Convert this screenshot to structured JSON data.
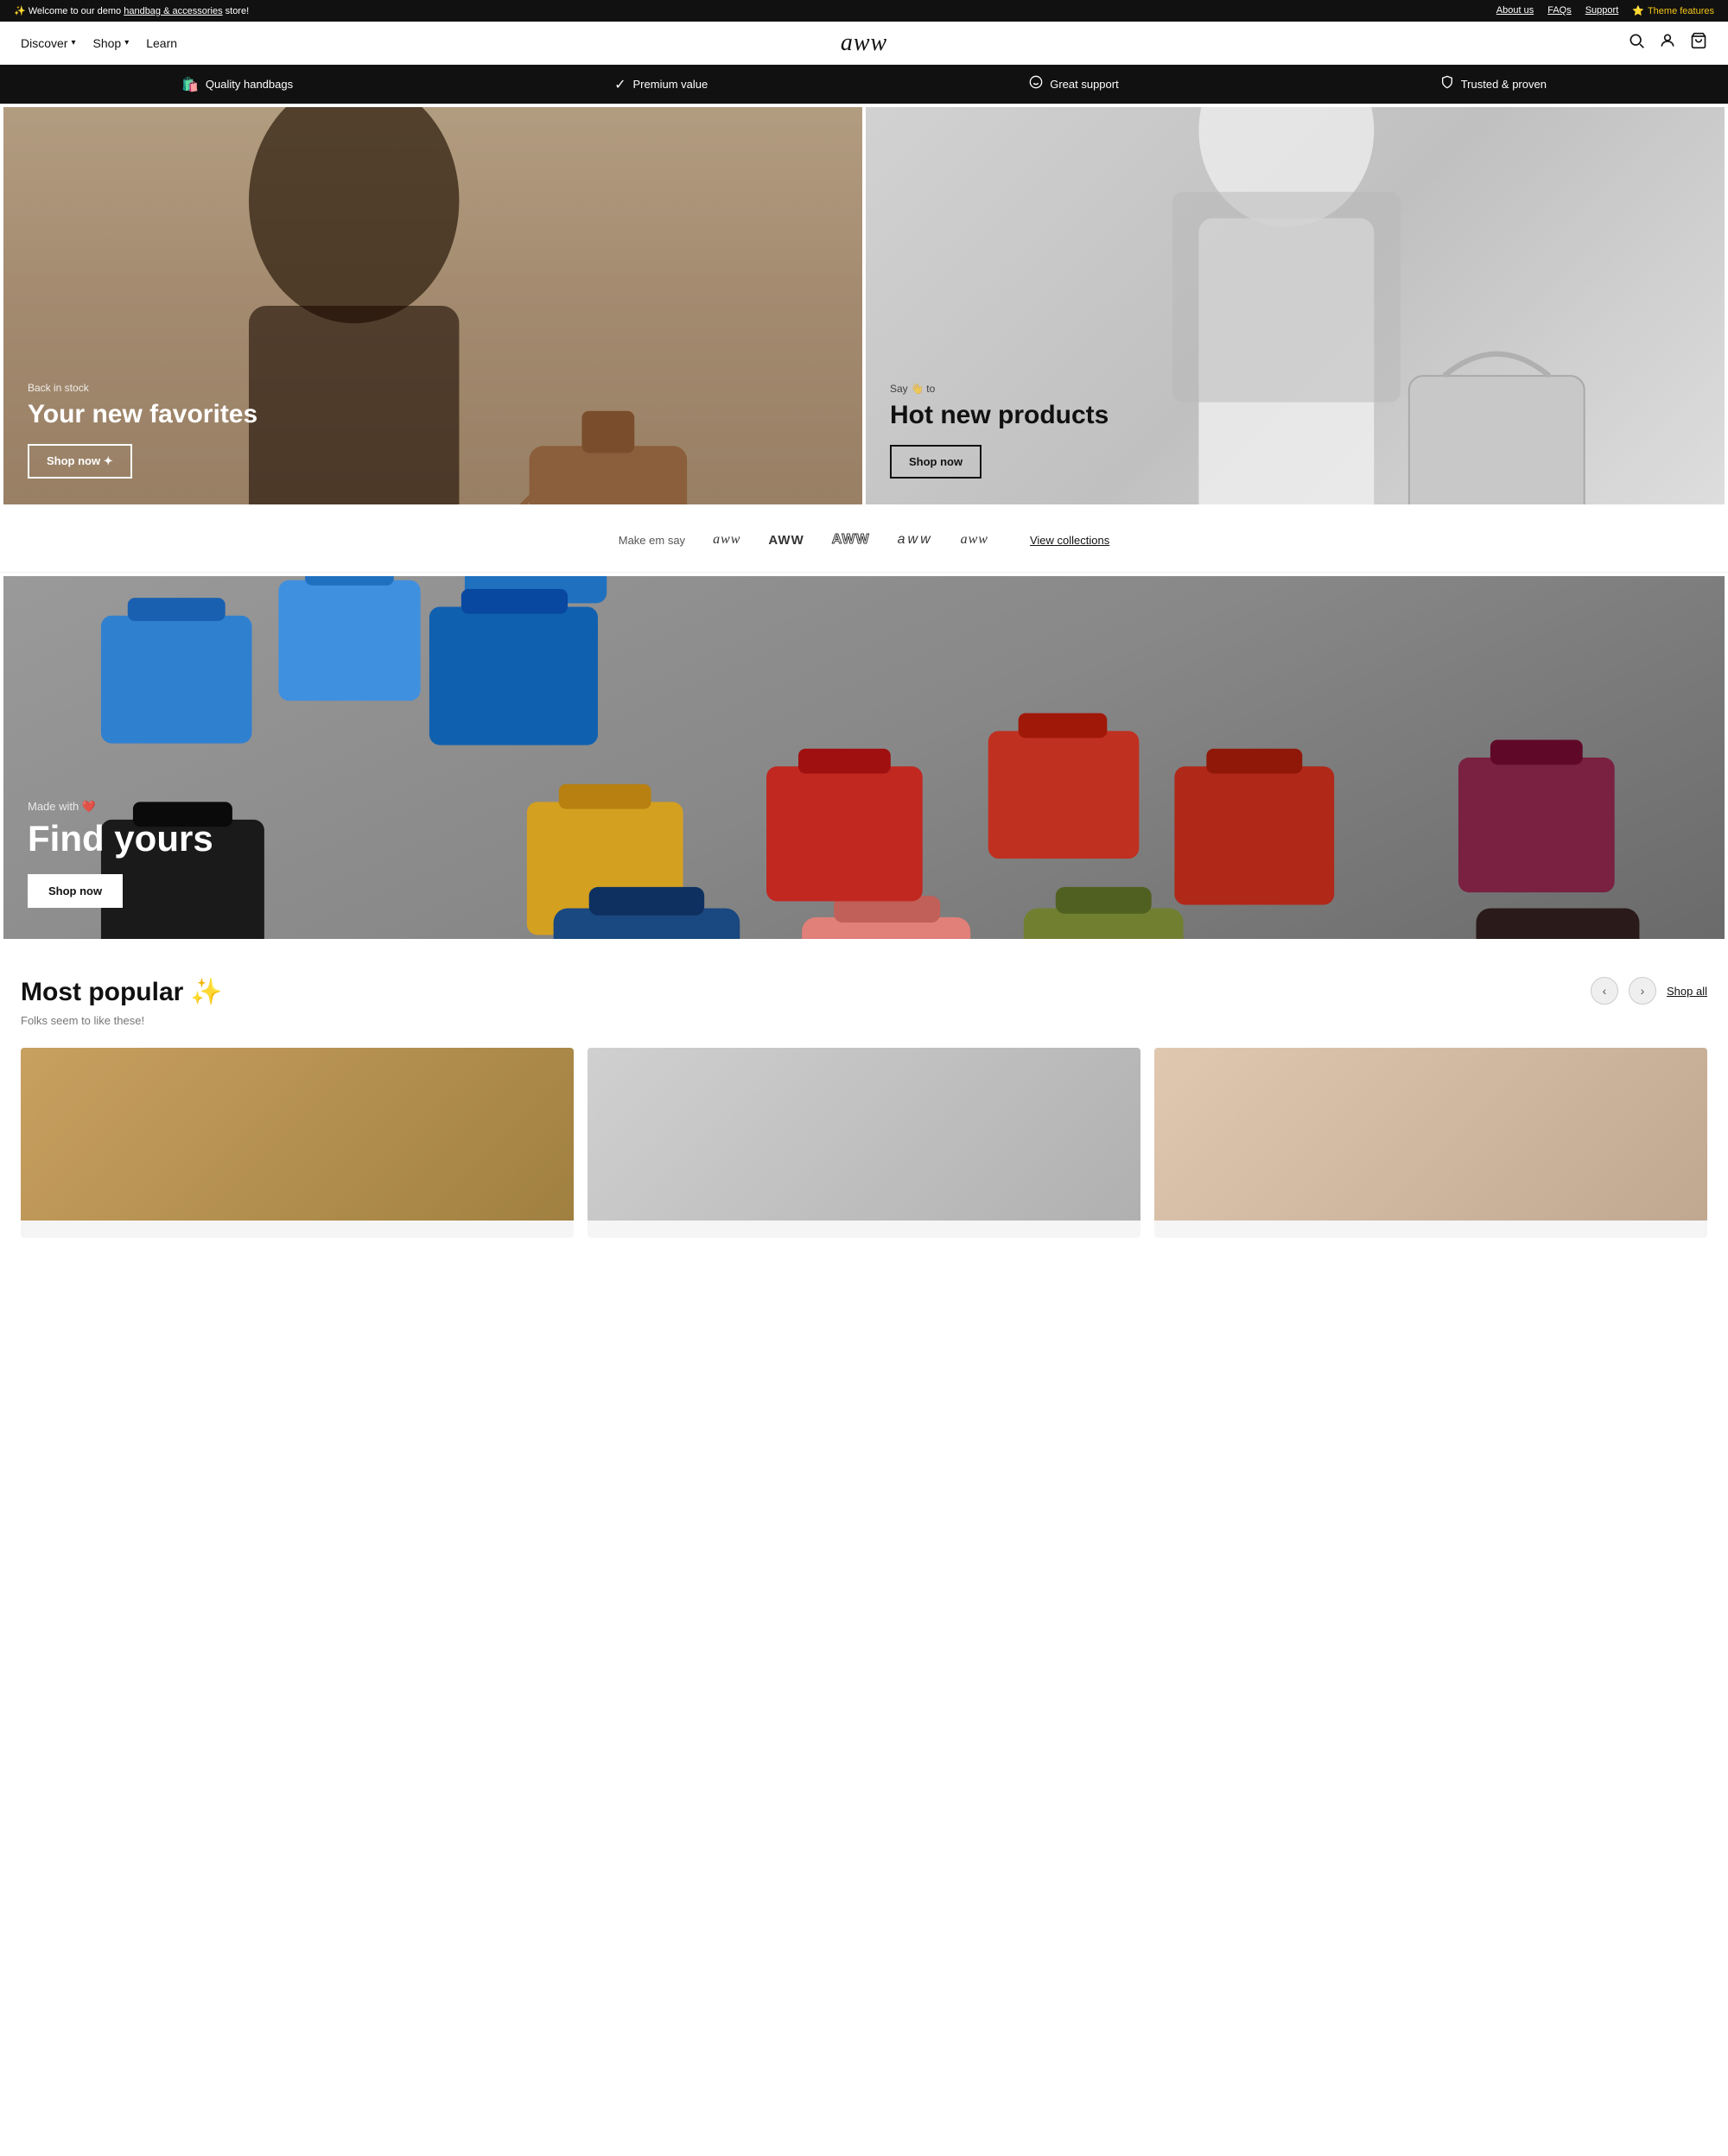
{
  "announcement": {
    "text": "Welcome to our demo ",
    "highlight": "handbag & accessories",
    "text_after": " store!",
    "links": [
      "About us",
      "FAQs",
      "Support"
    ],
    "theme_features_icon": "⭐",
    "theme_features_label": "Theme features"
  },
  "header": {
    "nav_items": [
      {
        "label": "Discover",
        "has_dropdown": true
      },
      {
        "label": "Shop",
        "has_dropdown": true
      },
      {
        "label": "Learn",
        "has_dropdown": true
      }
    ],
    "logo": "aww",
    "icons": {
      "search": "🔍",
      "account": "👤",
      "cart": "🛒"
    }
  },
  "feature_bar": {
    "items": [
      {
        "icon": "🛍️",
        "label": "Quality handbags"
      },
      {
        "icon": "✅",
        "label": "Premium value"
      },
      {
        "icon": "😊",
        "label": "Great support"
      },
      {
        "icon": "⭕",
        "label": "Trusted & proven"
      }
    ]
  },
  "hero": {
    "left": {
      "eyebrow": "Back in stock",
      "title": "Your new favorites",
      "cta": "Shop now ✦"
    },
    "right": {
      "eyebrow": "Say 👋 to",
      "title": "Hot new products",
      "cta": "Shop now"
    }
  },
  "brands": {
    "label": "Make em say",
    "logos": [
      {
        "text": "aww",
        "style": "serif"
      },
      {
        "text": "AWW",
        "style": "bold"
      },
      {
        "text": "AWW",
        "style": "outline"
      },
      {
        "text": "aww",
        "style": "normal"
      },
      {
        "text": "aww",
        "style": "script"
      }
    ],
    "view_collections": "View collections"
  },
  "banner": {
    "eyebrow": "Made with ❤️",
    "title": "Find yours",
    "cta": "Shop now"
  },
  "most_popular": {
    "title": "Most popular",
    "emoji": "✨",
    "subtitle": "Folks seem to like these!",
    "shop_all": "Shop all",
    "nav_prev": "‹",
    "nav_next": "›"
  },
  "colors": {
    "black": "#111111",
    "accent": "#f5c518",
    "light_gray": "#f5f5f5",
    "border": "#eeeeee"
  }
}
